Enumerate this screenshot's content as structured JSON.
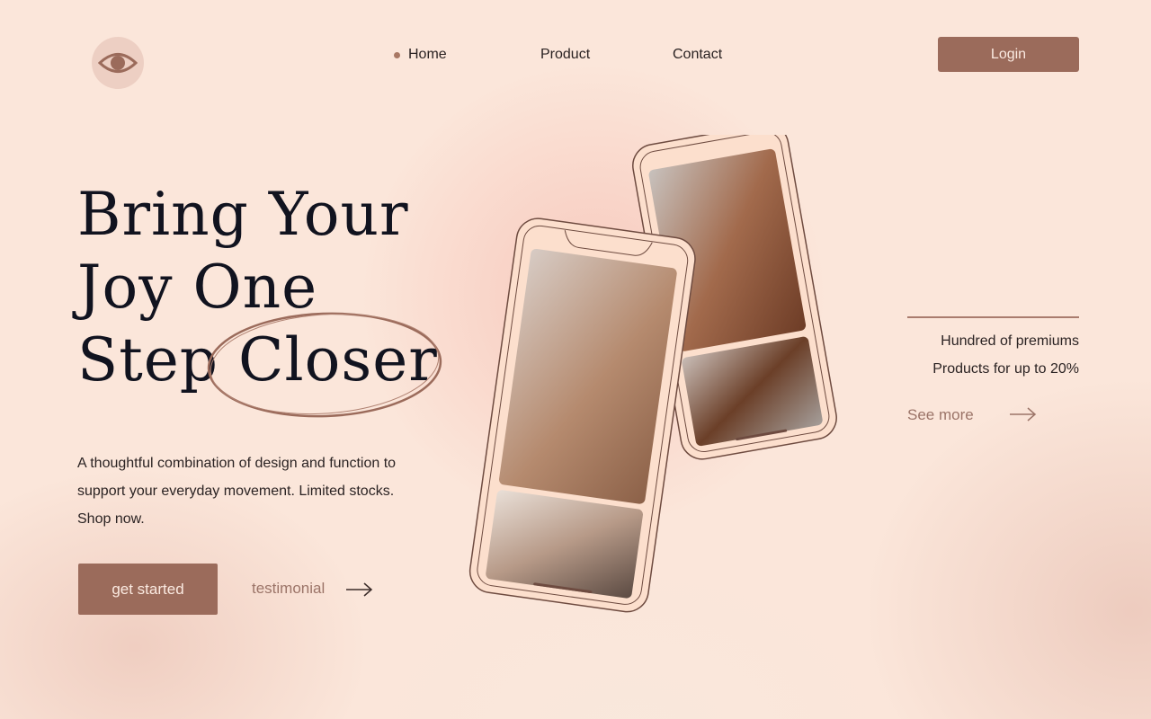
{
  "nav": {
    "items": [
      {
        "label": "Home",
        "active": true
      },
      {
        "label": "Product",
        "active": false
      },
      {
        "label": "Contact",
        "active": false
      }
    ],
    "login_label": "Login"
  },
  "logo": {
    "icon": "eye-icon"
  },
  "hero": {
    "title_lines": [
      "Bring Your",
      "Joy One",
      "Step Closer"
    ],
    "highlighted_word": "Closer",
    "description": "A thoughtful combination of design and function to support your everyday movement. Limited stocks. Shop now.",
    "cta_label": "get started",
    "secondary_label": "testimonial"
  },
  "side": {
    "line1": "Hundred of premiums",
    "line2": "Products for up to 20%",
    "link_label": "See more"
  },
  "colors": {
    "background": "#fbe6da",
    "accent": "#9b6b5b",
    "heading": "#11131f",
    "muted_link": "#9b7468"
  }
}
